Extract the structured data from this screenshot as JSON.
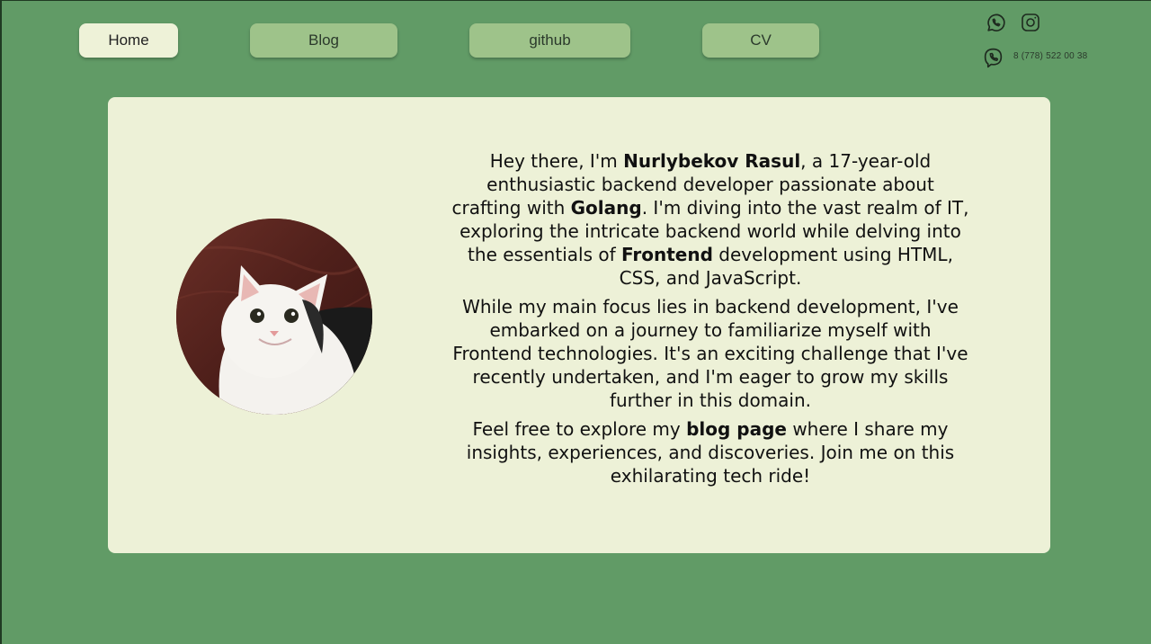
{
  "nav": {
    "items": [
      {
        "label": "Home",
        "active": true
      },
      {
        "label": "Blog",
        "active": false
      },
      {
        "label": "github",
        "active": false
      },
      {
        "label": "CV",
        "active": false
      }
    ]
  },
  "contacts": {
    "icons": [
      "whatsapp-icon",
      "instagram-icon",
      "viber-icon"
    ],
    "phone": "8 (778) 522 00 38"
  },
  "about": {
    "p1": {
      "t1": "Hey there, I'm ",
      "b1": "Nurlybekov Rasul",
      "t2": ", a 17-year-old enthusiastic backend developer passionate about crafting with ",
      "b2": "Golang",
      "t3": ". I'm diving into the vast realm of IT, exploring the intricate backend world while delving into the essentials of ",
      "b3": "Frontend",
      "t4": " development using HTML, CSS, and JavaScript."
    },
    "p2": "While my main focus lies in backend development, I've embarked on a journey to familiarize myself with Frontend technologies. It's an exciting challenge that I've recently undertaken, and I'm eager to grow my skills further in this domain.",
    "p3": {
      "t1": "Feel free to explore my ",
      "b1": "blog page",
      "t2": " where I share my insights, experiences, and discoveries. Join me on this exhilarating tech ride!"
    }
  },
  "colors": {
    "background": "#619b66",
    "card": "#edf1d7",
    "nav_button": "#9ec38a",
    "nav_active": "#eef2d8"
  }
}
